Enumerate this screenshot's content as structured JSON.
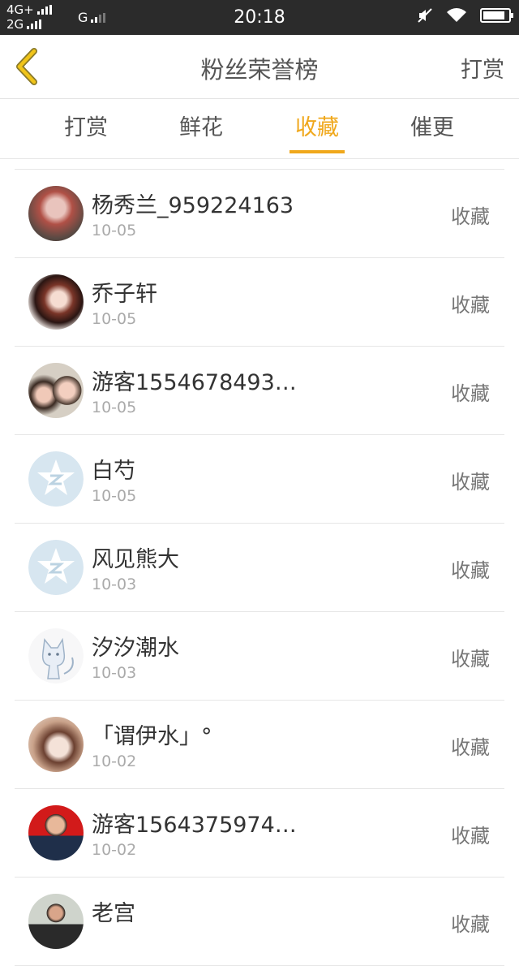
{
  "status_bar": {
    "network_top": "4G+",
    "network_bottom": "2G",
    "network_g": "G",
    "time": "20:18",
    "icons": [
      "signal-bars-icon",
      "mute-icon",
      "wifi-icon",
      "battery-charging-icon"
    ]
  },
  "header": {
    "back_icon": "chevron-left-icon",
    "title": "粉丝荣誉榜",
    "action_label": "打赏",
    "accent_color": "#f0a81c"
  },
  "tabs": [
    {
      "label": "打赏",
      "active": false
    },
    {
      "label": "鲜花",
      "active": false
    },
    {
      "label": "收藏",
      "active": true
    },
    {
      "label": "催更",
      "active": false
    }
  ],
  "list": {
    "items": [
      {
        "name": "杨秀兰_959224163",
        "date": "10-05",
        "action": "收藏",
        "avatar": "photo-avatar"
      },
      {
        "name": "乔子轩",
        "date": "10-05",
        "action": "收藏",
        "avatar": "anime-avatar"
      },
      {
        "name": "游客1554678493…",
        "date": "10-05",
        "action": "收藏",
        "avatar": "photo-avatar"
      },
      {
        "name": "白芍",
        "date": "10-05",
        "action": "收藏",
        "avatar": "default-star-avatar"
      },
      {
        "name": "风见熊大",
        "date": "10-03",
        "action": "收藏",
        "avatar": "default-star-avatar"
      },
      {
        "name": "汐汐潮水",
        "date": "10-03",
        "action": "收藏",
        "avatar": "cat-drawing-avatar"
      },
      {
        "name": "「谓伊水」°",
        "date": "10-02",
        "action": "收藏",
        "avatar": "illustration-avatar"
      },
      {
        "name": "游客1564375974…",
        "date": "10-02",
        "action": "收藏",
        "avatar": "photo-avatar"
      },
      {
        "name": "老宫",
        "date": "",
        "action": "收藏",
        "avatar": "photo-avatar"
      }
    ]
  }
}
